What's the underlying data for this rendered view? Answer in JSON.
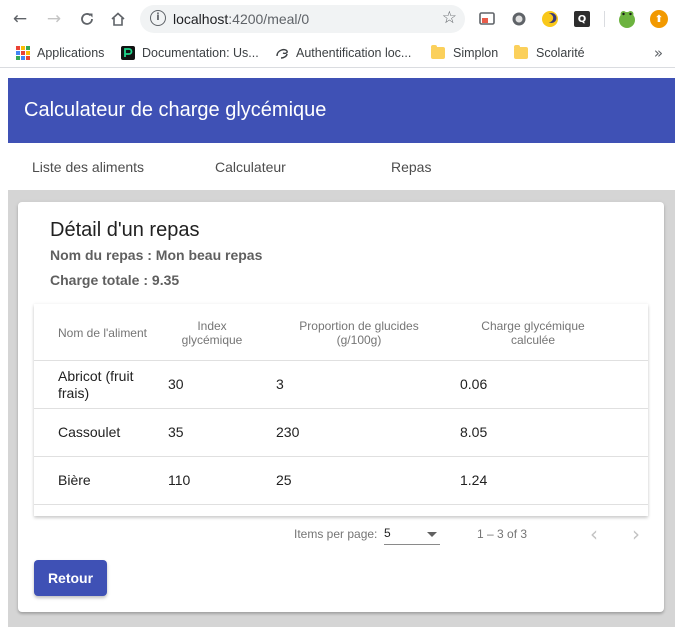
{
  "browser": {
    "url_host": "localhost",
    "url_path": ":4200/meal/0",
    "nav": {
      "back": "←",
      "forward": "→",
      "reload": "C",
      "home": "⌂"
    },
    "info_icon": "i",
    "star_icon": "☆",
    "extensions": [
      "cast-icon",
      "circle-icon",
      "moon-icon",
      "q-icon",
      "frog-avatar-icon",
      "update-icon"
    ],
    "extension_labels": {
      "q": "Q",
      "update": "⬆"
    },
    "bookmarks": [
      {
        "label": "Applications",
        "icon": "apps-grid-icon"
      },
      {
        "label": "Documentation: Us...",
        "icon": "postman-icon"
      },
      {
        "label": "Authentification loc...",
        "icon": "api-icon"
      },
      {
        "label": "Simplon",
        "icon": "folder-icon"
      },
      {
        "label": "Scolarité",
        "icon": "folder-icon"
      }
    ],
    "bookmarks_more": "»"
  },
  "app": {
    "title": "Calculateur de charge glycémique",
    "tabs": [
      "Liste des aliments",
      "Calculateur",
      "Repas"
    ],
    "accent_color": "#3f51b5"
  },
  "detail": {
    "title": "Détail d'un repas",
    "meal_name": "Nom du repas : Mon beau repas",
    "total_charge": "Charge totale : 9.35",
    "table": {
      "headers": [
        "Nom de l'aliment",
        "Index glycémique",
        "Proportion de glucides (g/100g)",
        "Charge glycémique calculée"
      ],
      "rows": [
        {
          "name": "Abricot (fruit frais)",
          "gi": "30",
          "carbs": "3",
          "charge": "0.06"
        },
        {
          "name": "Cassoulet",
          "gi": "35",
          "carbs": "230",
          "charge": "8.05"
        },
        {
          "name": "Bière",
          "gi": "110",
          "carbs": "25",
          "charge": "1.24"
        }
      ]
    },
    "paginator": {
      "items_per_page_label": "Items per page:",
      "items_per_page": "5",
      "range": "1 – 3 of 3",
      "prev_icon": "‹",
      "next_icon": "›"
    },
    "back_button": "Retour"
  }
}
